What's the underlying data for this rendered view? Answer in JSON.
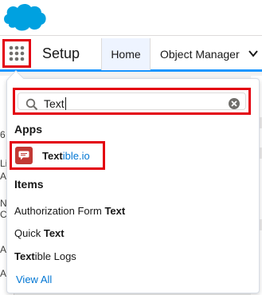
{
  "header": {
    "app_name": "Setup",
    "tabs": [
      {
        "label": "Home",
        "active": true
      },
      {
        "label": "Object Manager"
      }
    ]
  },
  "background_fragments": [
    "6",
    "Li",
    "A",
    "N",
    "C",
    "A",
    "A"
  ],
  "launcher": {
    "search": {
      "value": "Text"
    },
    "apps_heading": "Apps",
    "apps": [
      {
        "match": "Text",
        "rest": "ible.io",
        "icon": "chat-bubble-icon"
      }
    ],
    "items_heading": "Items",
    "items": [
      {
        "before": "Authorization Form ",
        "match": "Text",
        "after": ""
      },
      {
        "before": "Quick ",
        "match": "Text",
        "after": ""
      },
      {
        "before": "",
        "match": "Text",
        "after": "ible Logs"
      }
    ],
    "view_all": "View All"
  },
  "colors": {
    "brand_blue": "#00a1e0",
    "highlight_red": "#e3000f",
    "link_blue": "#0176d3",
    "app_icon_red": "#c23934"
  }
}
